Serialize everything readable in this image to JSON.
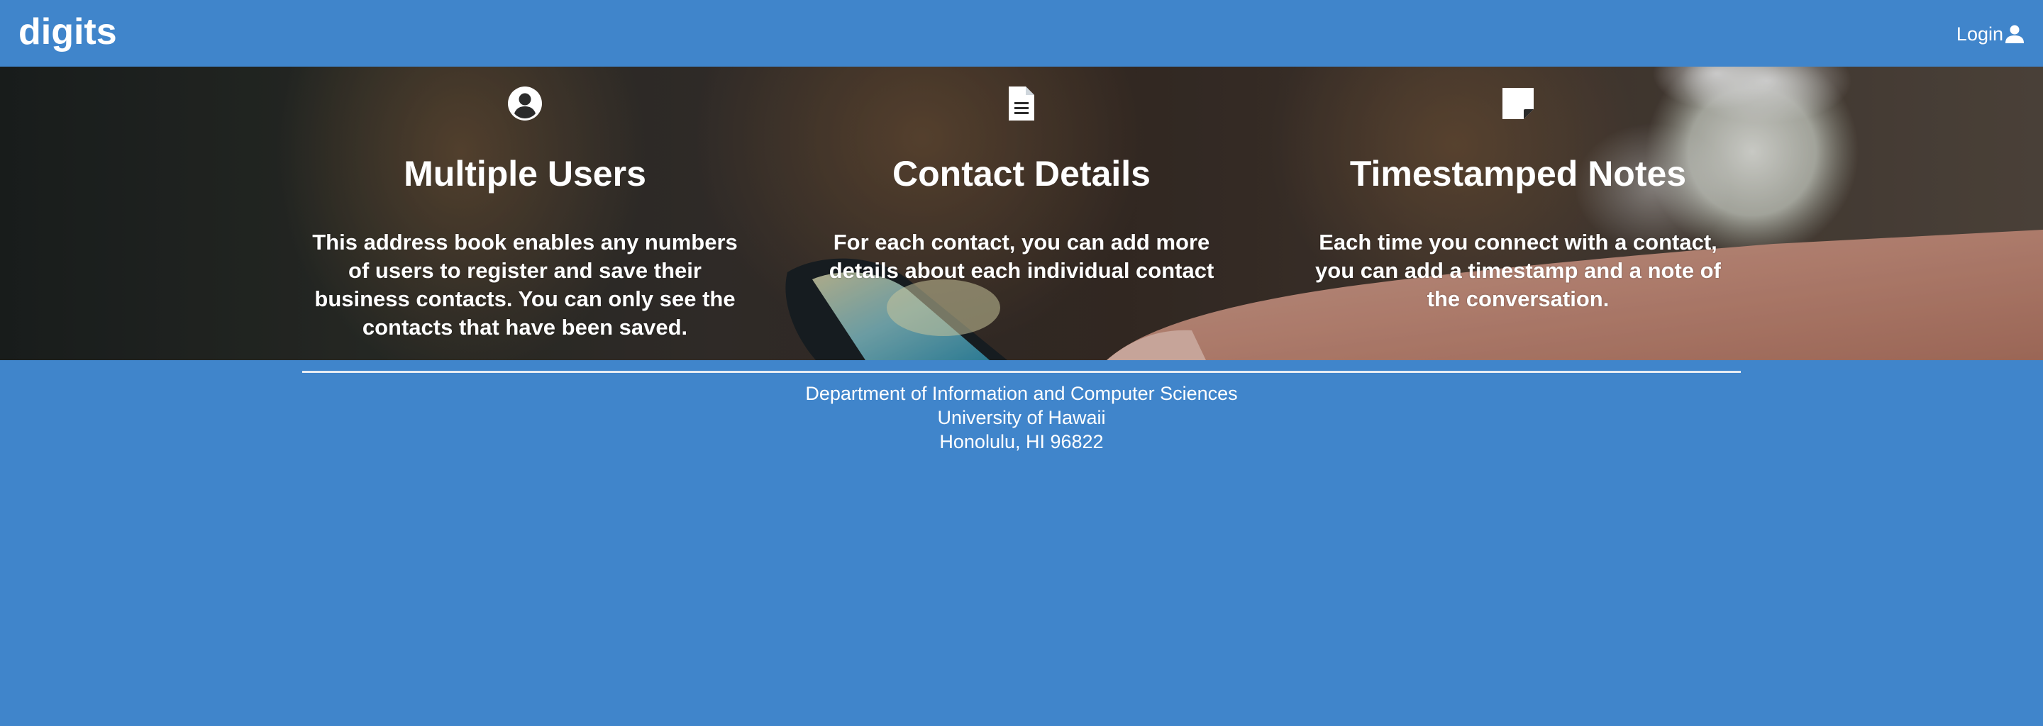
{
  "navbar": {
    "brand": "digits",
    "login_label": "Login"
  },
  "features": [
    {
      "icon": "user-circle-icon",
      "title": "Multiple Users",
      "description": "This address book enables any numbers of users to register and save their business contacts. You can only see the contacts that have been saved."
    },
    {
      "icon": "file-text-icon",
      "title": "Contact Details",
      "description": "For each contact, you can add more details about each individual contact"
    },
    {
      "icon": "sticky-note-icon",
      "title": "Timestamped Notes",
      "description": "Each time you connect with a contact, you can add a timestamp and a note of the conversation."
    }
  ],
  "footer": {
    "line1": "Department of Information and Computer Sciences",
    "line2": "University of Hawaii",
    "line3": "Honolulu, HI 96822"
  },
  "colors": {
    "primary": "#4085cb",
    "text": "#ffffff"
  }
}
